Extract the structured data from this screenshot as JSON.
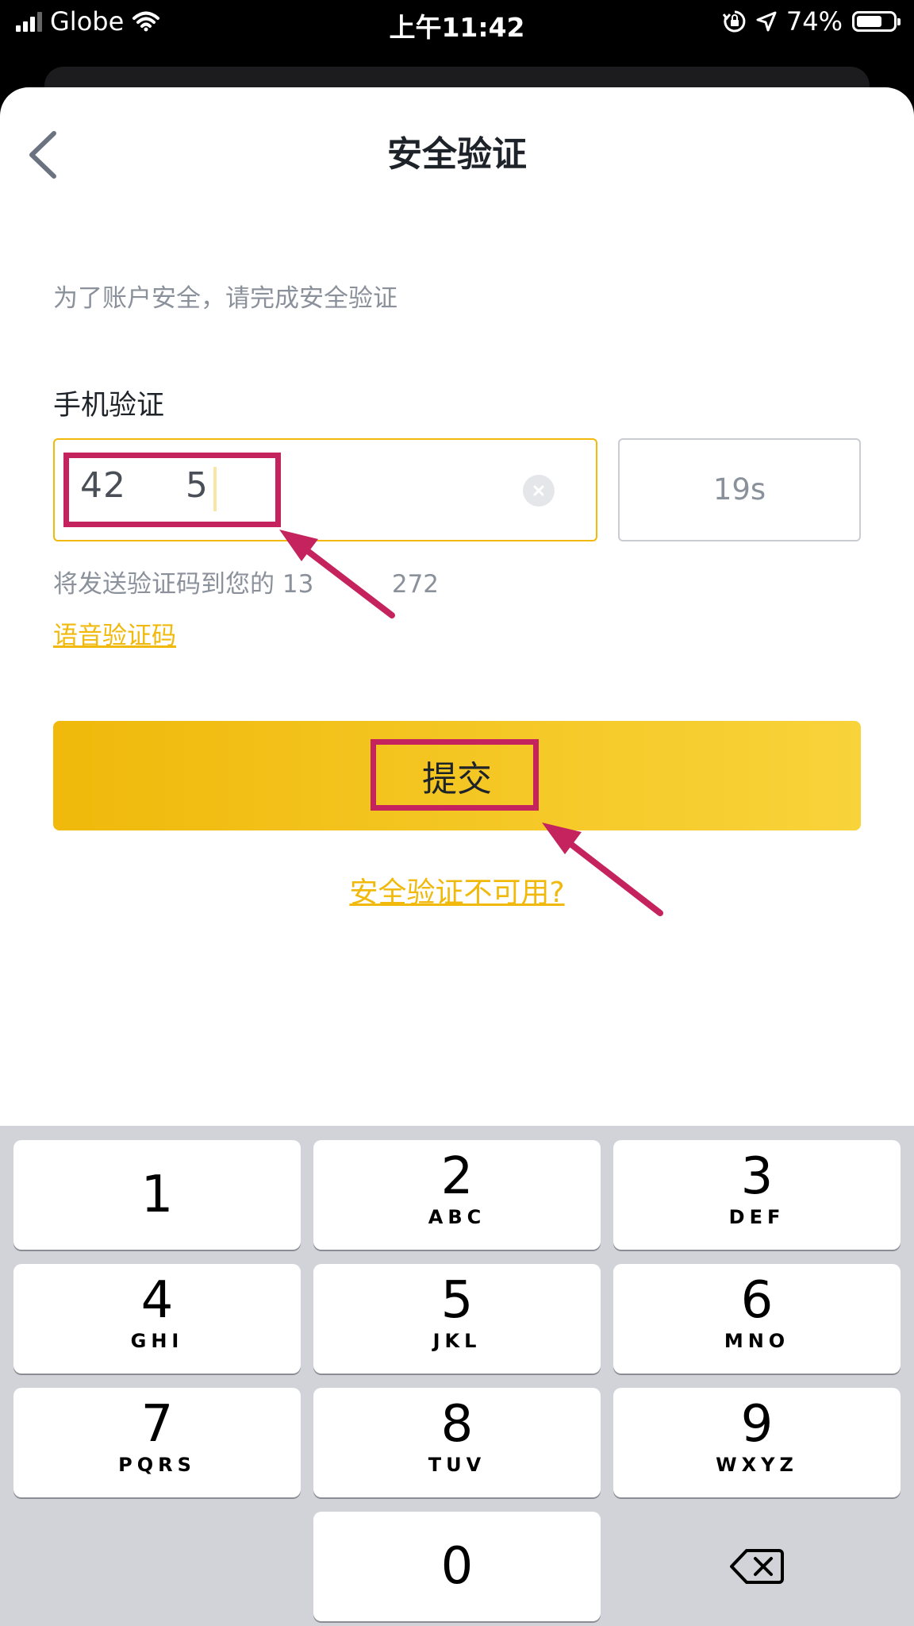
{
  "status_bar": {
    "carrier": "Globe",
    "time": "上午11:42",
    "battery": "74%",
    "battery_level": 0.74
  },
  "header": {
    "title": "安全验证"
  },
  "main": {
    "subtitle": "为了账户安全，请完成安全验证",
    "phone_section_label": "手机验证",
    "code_value": "42     5",
    "countdown": "19s",
    "send_hint": "将发送验证码到您的 13          272",
    "voice_link": "语音验证码",
    "submit_label": "提交",
    "unavailable_link": "安全验证不可用?"
  },
  "keypad": {
    "keys": [
      {
        "digit": "1",
        "letters": ""
      },
      {
        "digit": "2",
        "letters": "ABC"
      },
      {
        "digit": "3",
        "letters": "DEF"
      },
      {
        "digit": "4",
        "letters": "GHI"
      },
      {
        "digit": "5",
        "letters": "JKL"
      },
      {
        "digit": "6",
        "letters": "MNO"
      },
      {
        "digit": "7",
        "letters": "PQRS"
      },
      {
        "digit": "8",
        "letters": "TUV"
      },
      {
        "digit": "9",
        "letters": "WXYZ"
      },
      {
        "digit": "0",
        "letters": ""
      }
    ]
  },
  "colors": {
    "accent": "#f0b90b",
    "annotation": "#c5235d",
    "text_primary": "#1e2329",
    "text_secondary": "#8b919b"
  },
  "icons": {
    "back": "chevron-left-icon",
    "clear": "clear-circle-icon",
    "backspace": "backspace-icon",
    "wifi": "wifi-icon",
    "orientation_lock": "orientation-lock-icon",
    "location": "location-arrow-icon"
  }
}
